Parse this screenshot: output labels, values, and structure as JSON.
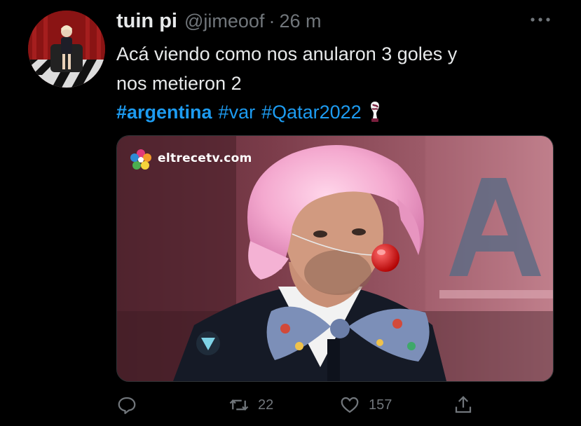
{
  "tweet": {
    "author": {
      "display_name": "tuin pi",
      "handle": "@jimeoof",
      "separator": "·",
      "time": "26 m"
    },
    "text_lines": [
      "Acá viendo como nos anularon 3 goles y",
      "nos metieron 2"
    ],
    "hashtags": [
      {
        "text": "#argentina",
        "bold": true
      },
      {
        "text": "#var",
        "bold": false
      },
      {
        "text": "#Qatar2022",
        "bold": false
      }
    ],
    "media": {
      "watermark": "eltrecetv.com",
      "background_letter": "A",
      "description_icon": "photo"
    },
    "actions": {
      "reply_count": "",
      "retweet_count": "22",
      "like_count": "157"
    }
  },
  "colors": {
    "background": "#000000",
    "text": "#e7e9ea",
    "secondary": "#71767b",
    "link": "#1d9bf0"
  }
}
